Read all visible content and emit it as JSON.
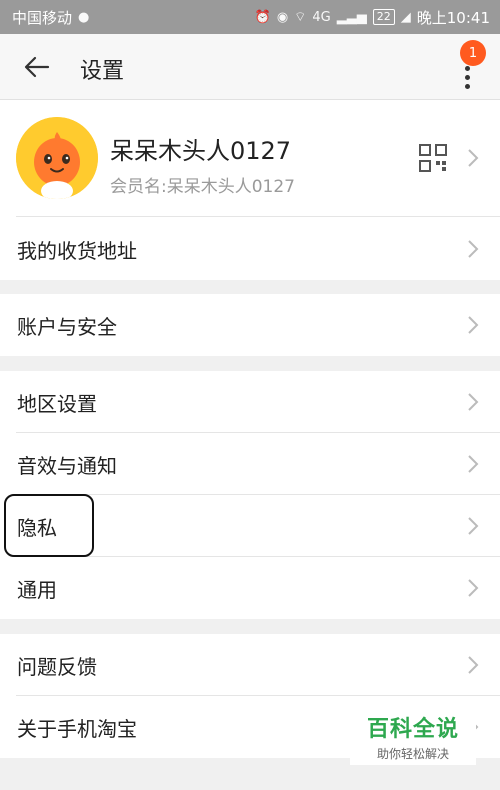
{
  "status_bar": {
    "carrier": "中国移动",
    "network": "4G",
    "battery": "22",
    "time": "晚上10:41"
  },
  "header": {
    "title": "设置",
    "notification_count": "1"
  },
  "profile": {
    "nickname": "呆呆木头人0127",
    "member_name": "会员名:呆呆木头人0127"
  },
  "sections": [
    {
      "items": [
        "我的收货地址"
      ]
    },
    {
      "items": [
        "账户与安全"
      ]
    },
    {
      "items": [
        "地区设置",
        "音效与通知",
        "隐私",
        "通用"
      ]
    },
    {
      "items": [
        "问题反馈",
        "关于手机淘宝"
      ]
    }
  ],
  "watermark": {
    "title": "百科全说",
    "subtitle": "助你轻松解决"
  },
  "colors": {
    "accent": "#ff5a1f",
    "watermark_green": "#2ea84f",
    "status_bar": "#9a9a9a"
  }
}
